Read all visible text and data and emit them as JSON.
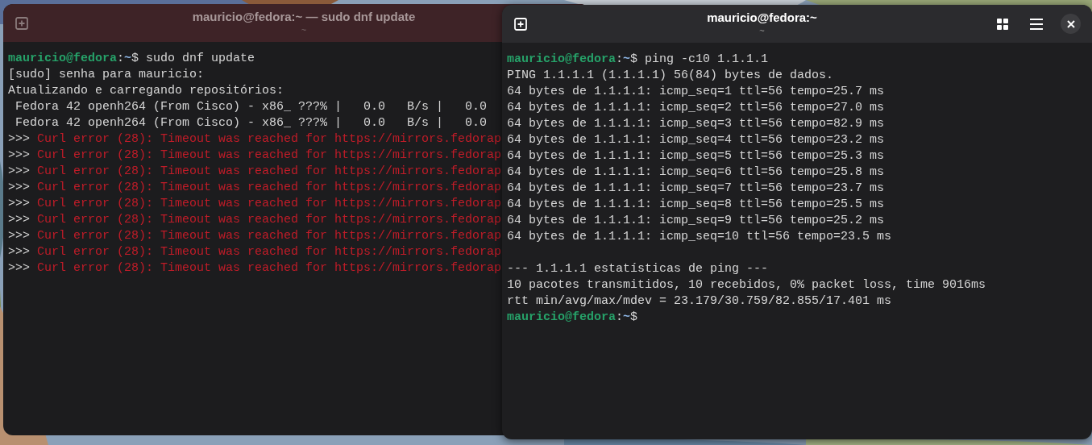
{
  "windows": [
    {
      "title": "mauricio@fedora:~ — sudo dnf update",
      "subtitle": "~",
      "active": false,
      "lines": [
        [
          {
            "kind": "user",
            "text": "mauricio@fedora"
          },
          {
            "kind": "plain",
            "text": ":"
          },
          {
            "kind": "path",
            "text": "~"
          },
          {
            "kind": "plain",
            "text": "$ sudo dnf update"
          }
        ],
        [
          {
            "kind": "plain",
            "text": "[sudo] senha para mauricio:"
          }
        ],
        [
          {
            "kind": "plain",
            "text": "Atualizando e carregando repositórios:"
          }
        ],
        [
          {
            "kind": "plain",
            "text": " Fedora 42 openh264 (From Cisco) - x86_ ???% |   0.0   B/s |   0.0"
          }
        ],
        [
          {
            "kind": "plain",
            "text": " Fedora 42 openh264 (From Cisco) - x86_ ???% |   0.0   B/s |   0.0"
          }
        ],
        [
          {
            "kind": "plain",
            "text": ">>> "
          },
          {
            "kind": "error",
            "text": "Curl error (28): Timeout was reached for https://mirrors.fedorap"
          }
        ],
        [
          {
            "kind": "plain",
            "text": ">>> "
          },
          {
            "kind": "error",
            "text": "Curl error (28): Timeout was reached for https://mirrors.fedorap"
          }
        ],
        [
          {
            "kind": "plain",
            "text": ">>> "
          },
          {
            "kind": "error",
            "text": "Curl error (28): Timeout was reached for https://mirrors.fedorap"
          }
        ],
        [
          {
            "kind": "plain",
            "text": ">>> "
          },
          {
            "kind": "error",
            "text": "Curl error (28): Timeout was reached for https://mirrors.fedorap"
          }
        ],
        [
          {
            "kind": "plain",
            "text": ">>> "
          },
          {
            "kind": "error",
            "text": "Curl error (28): Timeout was reached for https://mirrors.fedorap"
          }
        ],
        [
          {
            "kind": "plain",
            "text": ">>> "
          },
          {
            "kind": "error",
            "text": "Curl error (28): Timeout was reached for https://mirrors.fedorap"
          }
        ],
        [
          {
            "kind": "plain",
            "text": ">>> "
          },
          {
            "kind": "error",
            "text": "Curl error (28): Timeout was reached for https://mirrors.fedorap"
          }
        ],
        [
          {
            "kind": "plain",
            "text": ">>> "
          },
          {
            "kind": "error",
            "text": "Curl error (28): Timeout was reached for https://mirrors.fedorap"
          }
        ],
        [
          {
            "kind": "plain",
            "text": ">>> "
          },
          {
            "kind": "error",
            "text": "Curl error (28): Timeout was reached for https://mirrors.fedorap"
          }
        ]
      ]
    },
    {
      "title": "mauricio@fedora:~",
      "subtitle": "~",
      "active": true,
      "lines": [
        [
          {
            "kind": "user",
            "text": "mauricio@fedora"
          },
          {
            "kind": "plain",
            "text": ":"
          },
          {
            "kind": "path",
            "text": "~"
          },
          {
            "kind": "plain",
            "text": "$ ping -c10 1.1.1.1"
          }
        ],
        [
          {
            "kind": "plain",
            "text": "PING 1.1.1.1 (1.1.1.1) 56(84) bytes de dados."
          }
        ],
        [
          {
            "kind": "plain",
            "text": "64 bytes de 1.1.1.1: icmp_seq=1 ttl=56 tempo=25.7 ms"
          }
        ],
        [
          {
            "kind": "plain",
            "text": "64 bytes de 1.1.1.1: icmp_seq=2 ttl=56 tempo=27.0 ms"
          }
        ],
        [
          {
            "kind": "plain",
            "text": "64 bytes de 1.1.1.1: icmp_seq=3 ttl=56 tempo=82.9 ms"
          }
        ],
        [
          {
            "kind": "plain",
            "text": "64 bytes de 1.1.1.1: icmp_seq=4 ttl=56 tempo=23.2 ms"
          }
        ],
        [
          {
            "kind": "plain",
            "text": "64 bytes de 1.1.1.1: icmp_seq=5 ttl=56 tempo=25.3 ms"
          }
        ],
        [
          {
            "kind": "plain",
            "text": "64 bytes de 1.1.1.1: icmp_seq=6 ttl=56 tempo=25.8 ms"
          }
        ],
        [
          {
            "kind": "plain",
            "text": "64 bytes de 1.1.1.1: icmp_seq=7 ttl=56 tempo=23.7 ms"
          }
        ],
        [
          {
            "kind": "plain",
            "text": "64 bytes de 1.1.1.1: icmp_seq=8 ttl=56 tempo=25.5 ms"
          }
        ],
        [
          {
            "kind": "plain",
            "text": "64 bytes de 1.1.1.1: icmp_seq=9 ttl=56 tempo=25.2 ms"
          }
        ],
        [
          {
            "kind": "plain",
            "text": "64 bytes de 1.1.1.1: icmp_seq=10 ttl=56 tempo=23.5 ms"
          }
        ],
        {
          "kind": "blank"
        },
        [
          {
            "kind": "plain",
            "text": "--- 1.1.1.1 estatísticas de ping ---"
          }
        ],
        [
          {
            "kind": "plain",
            "text": "10 pacotes transmitidos, 10 recebidos, 0% packet loss, time 9016ms"
          }
        ],
        [
          {
            "kind": "plain",
            "text": "rtt min/avg/max/mdev = 23.179/30.759/82.855/17.401 ms"
          }
        ],
        [
          {
            "kind": "user",
            "text": "mauricio@fedora"
          },
          {
            "kind": "plain",
            "text": ":"
          },
          {
            "kind": "path",
            "text": "~"
          },
          {
            "kind": "plain",
            "text": "$"
          }
        ]
      ]
    }
  ]
}
